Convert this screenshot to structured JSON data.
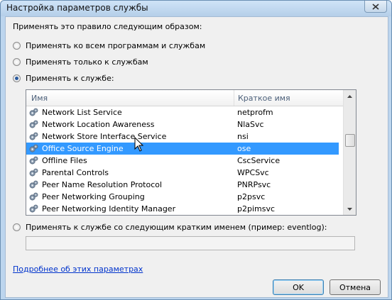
{
  "window": {
    "title": "Настройка параметров службы"
  },
  "intro_text": "Применять это правило следующим образом:",
  "options": {
    "all": "Применять ко всем программам и службам",
    "services_only": "Применять только к службам",
    "to_service": "Применять к службе:",
    "short_name": "Применять к службе со следующим кратким именем (пример: eventlog):"
  },
  "selected_option": "to_service",
  "list": {
    "headers": {
      "name": "Имя",
      "short": "Краткое имя"
    },
    "rows": [
      {
        "name": "Network List Service",
        "short": "netprofm"
      },
      {
        "name": "Network Location Awareness",
        "short": "NlaSvc"
      },
      {
        "name": "Network Store Interface Service",
        "short": "nsi"
      },
      {
        "name": "Office Source Engine",
        "short": "ose"
      },
      {
        "name": "Offline Files",
        "short": "CscService"
      },
      {
        "name": "Parental Controls",
        "short": "WPCSvc"
      },
      {
        "name": "Peer Name Resolution Protocol",
        "short": "PNRPsvc"
      },
      {
        "name": "Peer Networking Grouping",
        "short": "p2psvc"
      },
      {
        "name": "Peer Networking Identity Manager",
        "short": "p2pimsvc"
      }
    ],
    "selected_index": 3
  },
  "short_name_input": {
    "value": ""
  },
  "more_info_link": "Подробнее об этих параметрах",
  "buttons": {
    "ok": "OK",
    "cancel": "Отмена"
  },
  "colors": {
    "selection": "#3399ff",
    "link": "#0033cc"
  }
}
